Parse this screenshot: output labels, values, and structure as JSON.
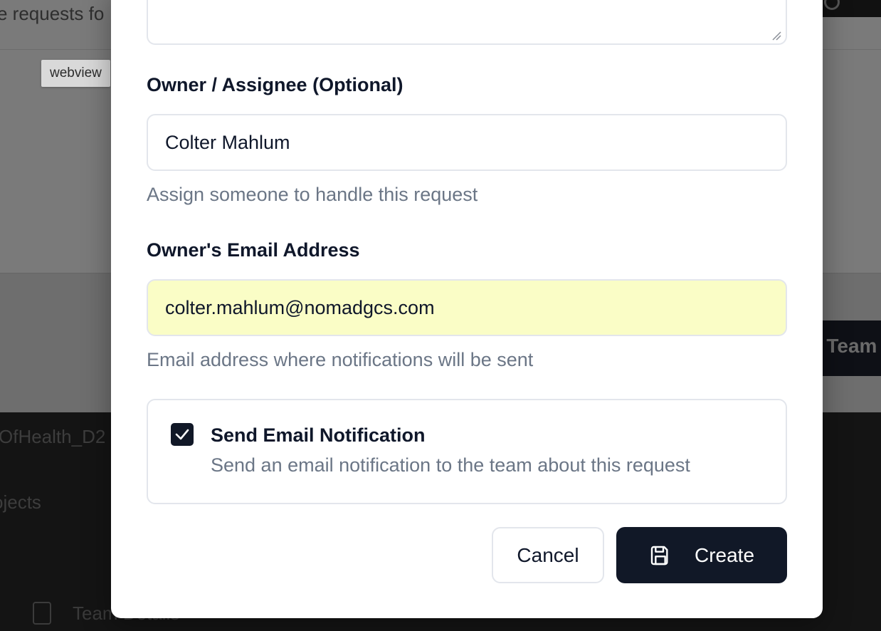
{
  "background": {
    "top_text": "e requests fo",
    "button_text": "e Team",
    "dark_text_1": "OfHealth_D2",
    "dark_text_2": "ojects",
    "nav_item_label": "Team Details"
  },
  "tooltip": {
    "label": "webview"
  },
  "form": {
    "owner": {
      "label": "Owner / Assignee (Optional)",
      "value": "Colter Mahlum",
      "hint": "Assign someone to handle this request"
    },
    "email": {
      "label": "Owner's Email Address",
      "value": "colter.mahlum@nomadgcs.com",
      "hint": "Email address where notifications will be sent"
    },
    "notification": {
      "checked": true,
      "title": "Send Email Notification",
      "description": "Send an email notification to the team about this request"
    }
  },
  "actions": {
    "cancel_label": "Cancel",
    "create_label": "Create",
    "create_icon": "save-icon"
  },
  "colors": {
    "primary": "#111827",
    "autofill": "#fafdc6",
    "hint_text": "#6b7686"
  }
}
